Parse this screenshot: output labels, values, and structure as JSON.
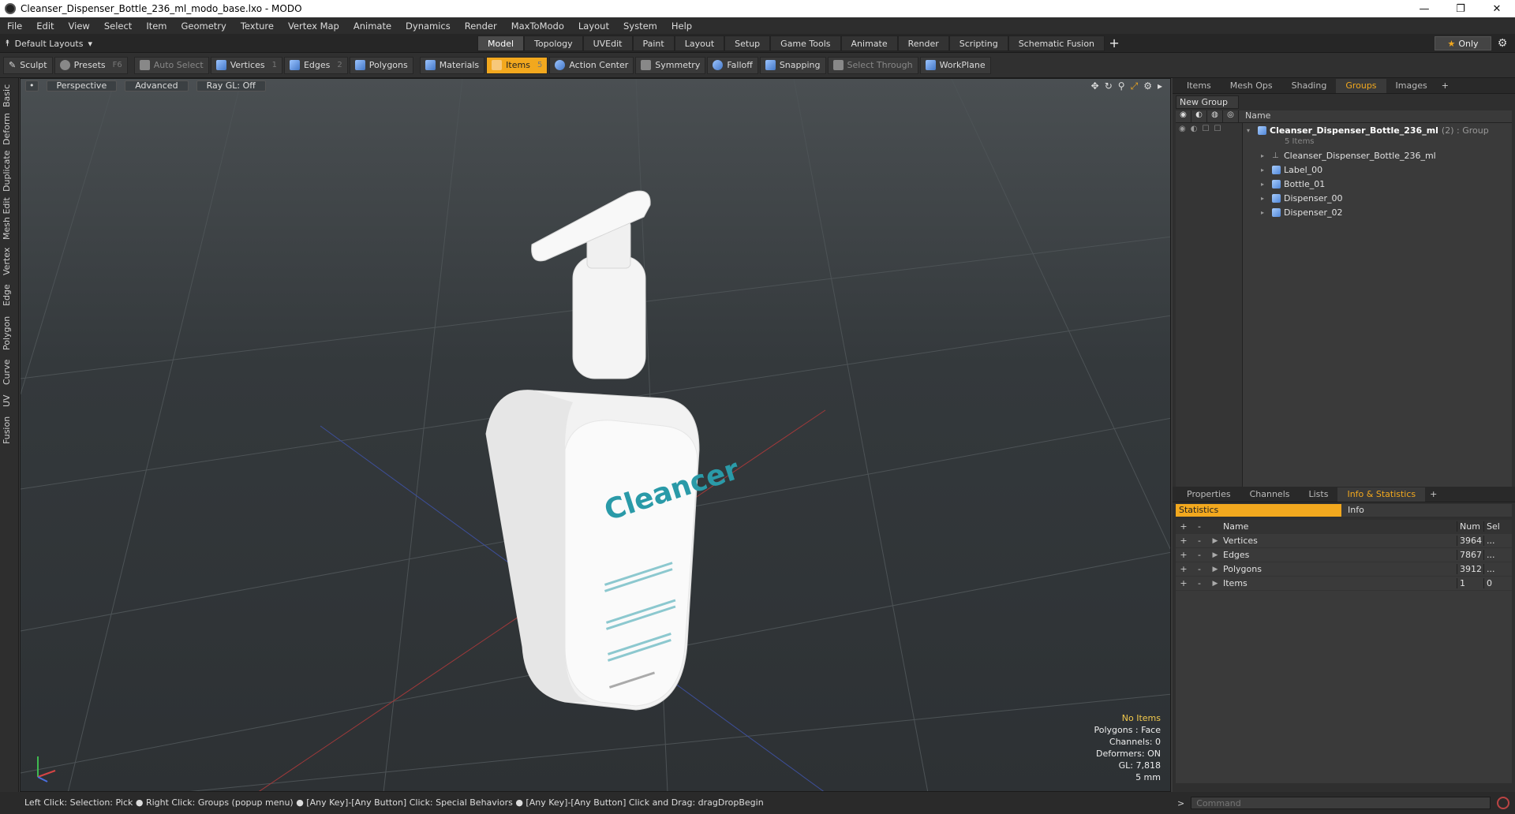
{
  "window": {
    "title": "Cleanser_Dispenser_Bottle_236_ml_modo_base.lxo - MODO"
  },
  "menu": [
    "File",
    "Edit",
    "View",
    "Select",
    "Item",
    "Geometry",
    "Texture",
    "Vertex Map",
    "Animate",
    "Dynamics",
    "Render",
    "MaxToModo",
    "Layout",
    "System",
    "Help"
  ],
  "layout": {
    "selector": "Default Layouts",
    "tabs": [
      "Model",
      "Topology",
      "UVEdit",
      "Paint",
      "Layout",
      "Setup",
      "Game Tools",
      "Animate",
      "Render",
      "Scripting",
      "Schematic Fusion"
    ],
    "active_tab": "Model",
    "only_label": "Only"
  },
  "toolbar": {
    "sculpt": "Sculpt",
    "presets": "Presets",
    "presets_key": "F6",
    "auto_select": "Auto Select",
    "vertices": "Vertices",
    "vertices_key": "1",
    "edges": "Edges",
    "edges_key": "2",
    "polygons": "Polygons",
    "materials": "Materials",
    "items": "Items",
    "items_key": "5",
    "action_center": "Action Center",
    "symmetry": "Symmetry",
    "falloff": "Falloff",
    "snapping": "Snapping",
    "select_through": "Select Through",
    "workplane": "WorkPlane"
  },
  "lefttabs": [
    "Basic",
    "Deform",
    "Duplicate",
    "Mesh Edit",
    "Vertex",
    "Edge",
    "Polygon",
    "Curve",
    "UV",
    "Fusion"
  ],
  "viewport": {
    "view": "Perspective",
    "shading": "Advanced",
    "raygl": "Ray GL: Off",
    "label_brand": "Cleancer",
    "overlay": {
      "selection": "No Items",
      "polygons": "Polygons : Face",
      "channels": "Channels: 0",
      "deformers": "Deformers: ON",
      "gl": "GL: 7,818",
      "scale": "5 mm"
    }
  },
  "panel_top": {
    "tabs": [
      "Items",
      "Mesh Ops",
      "Shading",
      "Groups",
      "Images"
    ],
    "active": "Groups",
    "new_group": "New Group",
    "name_col": "Name",
    "group_name": "Cleanser_Dispenser_Bottle_236_ml",
    "group_suffix": "(2) : Group",
    "group_count": "5 Items",
    "children": [
      "Cleanser_Dispenser_Bottle_236_ml",
      "Label_00",
      "Bottle_01",
      "Dispenser_00",
      "Dispenser_02"
    ]
  },
  "panel_bottom": {
    "tabs": [
      "Properties",
      "Channels",
      "Lists",
      "Info & Statistics"
    ],
    "active": "Info & Statistics",
    "sub_statistics": "Statistics",
    "sub_info": "Info",
    "head": {
      "name": "Name",
      "num": "Num",
      "sel": "Sel"
    },
    "rows": [
      {
        "name": "Vertices",
        "num": "3964",
        "sel": "..."
      },
      {
        "name": "Edges",
        "num": "7867",
        "sel": "..."
      },
      {
        "name": "Polygons",
        "num": "3912",
        "sel": "..."
      },
      {
        "name": "Items",
        "num": "1",
        "sel": "0"
      }
    ]
  },
  "status": {
    "text": "Left Click: Selection: Pick ● Right Click: Groups (popup menu) ● [Any Key]-[Any Button] Click: Special Behaviors ● [Any Key]-[Any Button] Click and Drag: dragDropBegin",
    "command_placeholder": "Command"
  }
}
